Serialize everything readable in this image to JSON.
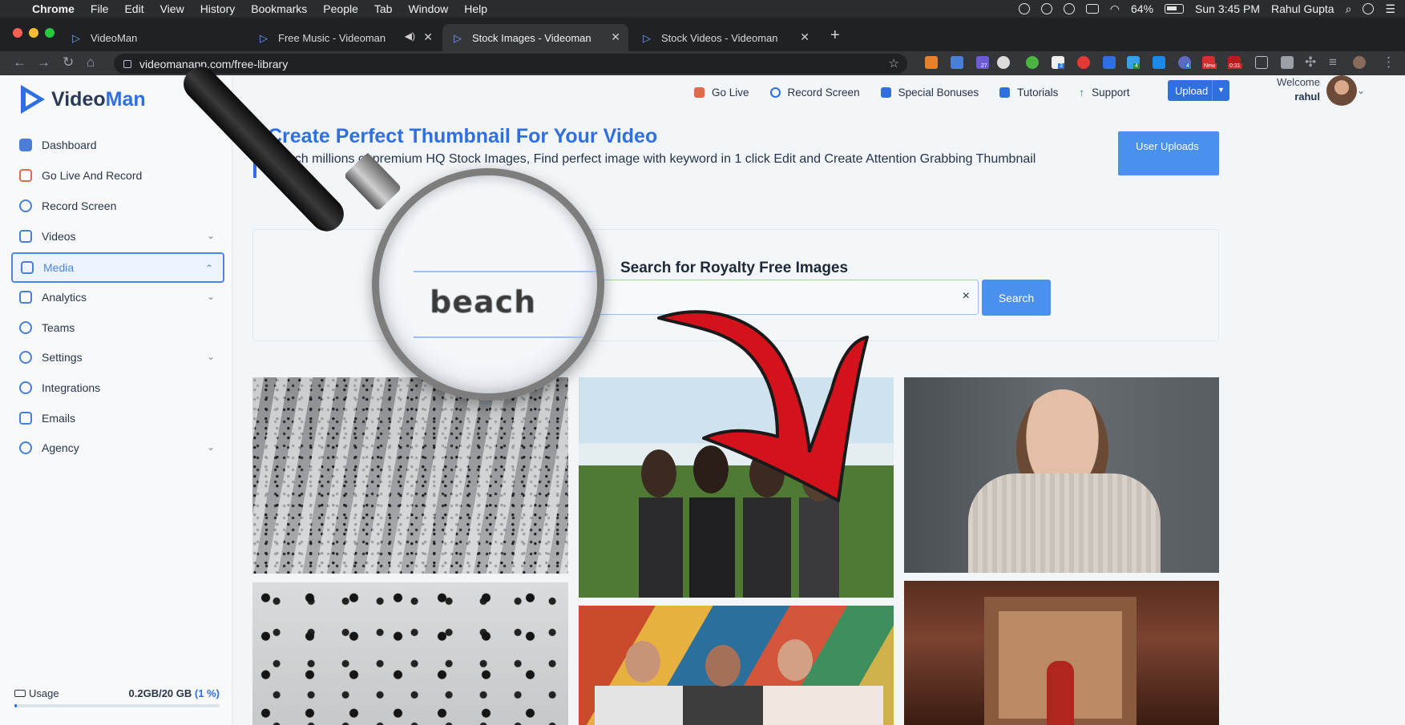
{
  "menubar": {
    "app": "Chrome",
    "items": [
      "File",
      "Edit",
      "View",
      "History",
      "Bookmarks",
      "People",
      "Tab",
      "Window",
      "Help"
    ],
    "battery": "64%",
    "clock": "Sun 3:45 PM",
    "user": "Rahul Gupta"
  },
  "tabs": [
    {
      "title": "VideoMan",
      "active": false
    },
    {
      "title": "Free Music - Videoman",
      "active": false
    },
    {
      "title": "Stock Images - Videoman",
      "active": true
    },
    {
      "title": "Stock Videos - Videoman",
      "active": false
    }
  ],
  "omnibox": {
    "url": "videomanapp.com/free-library"
  },
  "extension_badges": [
    "27",
    "3",
    "4",
    "4",
    "New",
    "0:31"
  ],
  "sidebar": {
    "logo": {
      "video": "Video",
      "man": "Man"
    },
    "items": [
      {
        "label": "Dashboard",
        "icon": "dashboard-icon",
        "chevron": false
      },
      {
        "label": "Go Live And Record",
        "icon": "live-icon",
        "chevron": false
      },
      {
        "label": "Record Screen",
        "icon": "record-icon",
        "chevron": false
      },
      {
        "label": "Videos",
        "icon": "video-icon",
        "chevron": true
      },
      {
        "label": "Media",
        "icon": "media-icon",
        "chevron": true,
        "active": true
      },
      {
        "label": "Analytics",
        "icon": "analytics-icon",
        "chevron": true
      },
      {
        "label": "Teams",
        "icon": "teams-icon",
        "chevron": false
      },
      {
        "label": "Settings",
        "icon": "settings-icon",
        "chevron": true
      },
      {
        "label": "Integrations",
        "icon": "integrations-icon",
        "chevron": false
      },
      {
        "label": "Emails",
        "icon": "emails-icon",
        "chevron": false
      },
      {
        "label": "Agency",
        "icon": "agency-icon",
        "chevron": true
      }
    ],
    "usage": {
      "label": "Usage",
      "value": "0.2GB/20 GB",
      "percent_label": "1 %",
      "fraction": 0.01
    }
  },
  "topnav": {
    "items": [
      "Go Live",
      "Record Screen",
      "Special Bonuses",
      "Tutorials",
      "Support"
    ],
    "upload": "Upload",
    "welcome": "Welcome",
    "username": "rahul"
  },
  "hero": {
    "title": "Create Perfect Thumbnail For Your Video",
    "subtitle": "Search millions of premium HQ Stock Images, Find perfect image with keyword in 1 click Edit and Create Attention Grabbing Thumbnail",
    "user_uploads": "User Uploads"
  },
  "search": {
    "heading": "Search for Royalty Free Images",
    "query": "beach",
    "clear": "×",
    "button": "Search"
  },
  "colors": {
    "accent": "#2f6fe0",
    "button": "#4a90ee",
    "arrow": "#d3121b"
  }
}
